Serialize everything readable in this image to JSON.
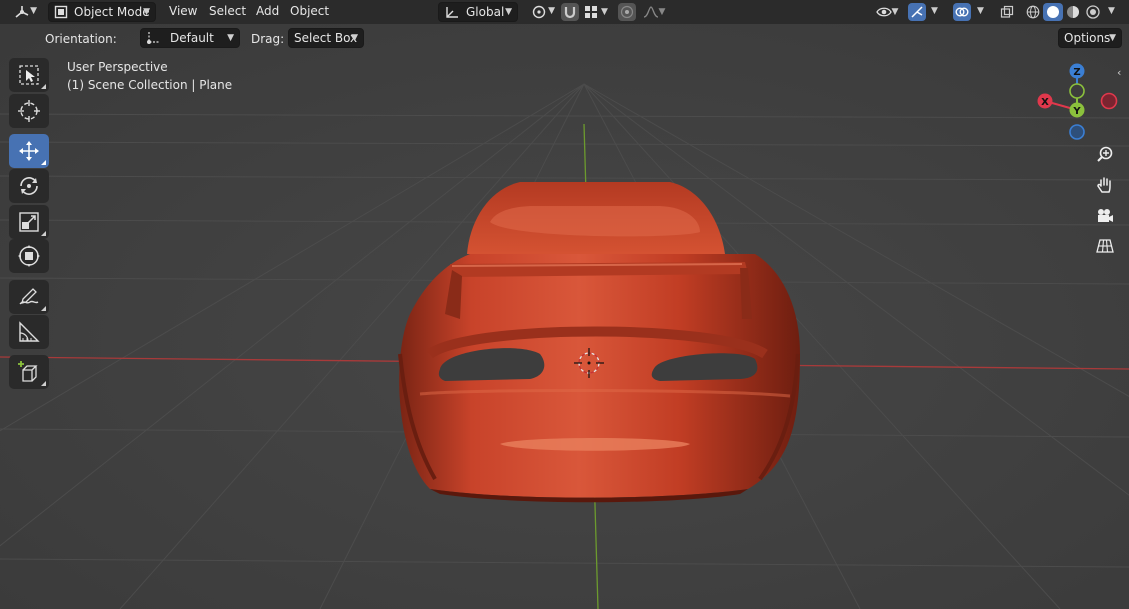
{
  "header": {
    "mode": "Object Mode",
    "menus": [
      "View",
      "Select",
      "Add",
      "Object"
    ],
    "transform_orientation": "Global"
  },
  "toolsettings": {
    "orientation_label": "Orientation:",
    "orientation_value": "Default",
    "drag_label": "Drag:",
    "drag_value": "Select Box",
    "options_label": "Options"
  },
  "viewport": {
    "perspective": "User Perspective",
    "collection": "(1) Scene Collection | Plane"
  },
  "gizmo": {
    "x": "X",
    "y": "Y",
    "z": "Z"
  },
  "tools": [
    {
      "name": "select-box-tool"
    },
    {
      "name": "cursor-tool"
    },
    {
      "name": "move-tool",
      "active": true
    },
    {
      "name": "rotate-tool"
    },
    {
      "name": "scale-tool"
    },
    {
      "name": "transform-tool"
    },
    {
      "name": "annotate-tool"
    },
    {
      "name": "measure-tool"
    },
    {
      "name": "add-cube-tool"
    }
  ],
  "colors": {
    "accent": "#4772b3",
    "axis_x": "#e0384c",
    "axis_y": "#8bc13c",
    "axis_z": "#3b7fd4",
    "object": "#c8432a"
  }
}
